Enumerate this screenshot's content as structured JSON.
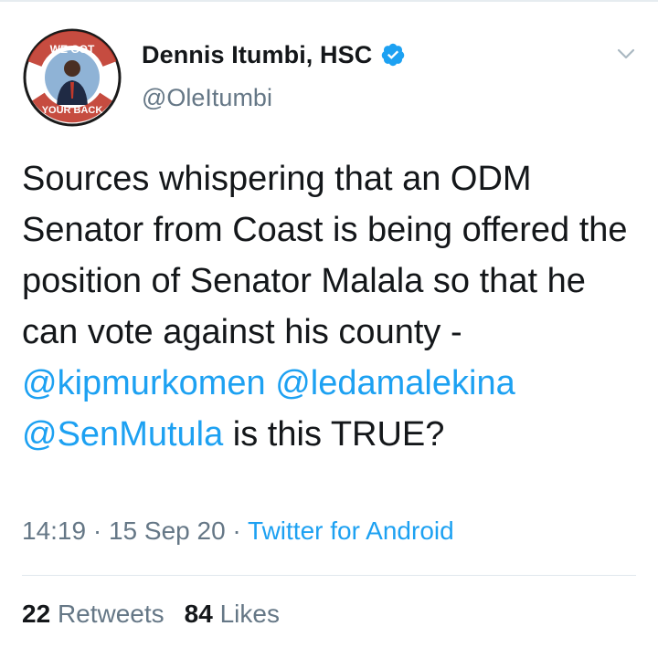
{
  "author": {
    "display_name": "Dennis Itumbi, HSC",
    "handle": "@OleItumbi",
    "verified": true,
    "avatar": {
      "badge_text_top": "WE GOT",
      "badge_text_bottom": "YOUR BACK",
      "ring_color": "#c0392b"
    }
  },
  "tweet": {
    "text_part1": "Sources whispering that an ODM Senator from Coast is being offered the position of Senator Malala so that he can vote against his county - ",
    "mention1": "@kipmurkomen",
    "mention2": "@ledamalekina",
    "mention3": "@SenMutula",
    "text_part2": " is this TRUE?"
  },
  "meta": {
    "time": "14:19",
    "separator": " · ",
    "date": "15 Sep 20",
    "source": "Twitter for Android"
  },
  "stats": {
    "retweets_count": "22",
    "retweets_label": "Retweets",
    "likes_count": "84",
    "likes_label": "Likes"
  },
  "colors": {
    "link": "#1da1f2",
    "secondary": "#657786",
    "primary_text": "#14171a",
    "verified": "#1da1f2"
  },
  "icons": {
    "verified": "verified-badge-icon",
    "caret": "chevron-down-icon"
  }
}
